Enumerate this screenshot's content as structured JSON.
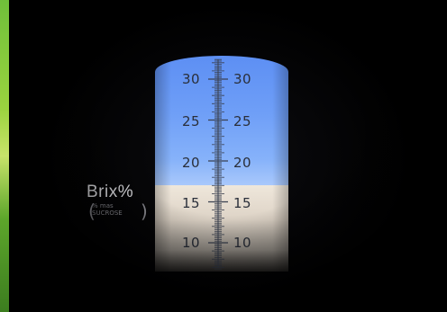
{
  "refractometer": {
    "scale_label": "Brix%",
    "scale_sub_line1": "% mas",
    "scale_sub_line2": "SUCROSE",
    "left_numbers": [
      "30",
      "25",
      "20",
      "15",
      "10"
    ],
    "right_numbers": [
      "30",
      "25",
      "20",
      "15",
      "10"
    ],
    "boundary_reading_brix": 16.5
  },
  "colors": {
    "upper_field": "#6f9ff7",
    "lower_field": "#e8e0d3",
    "background": "#000000",
    "edge_green": "#9bd43f"
  }
}
